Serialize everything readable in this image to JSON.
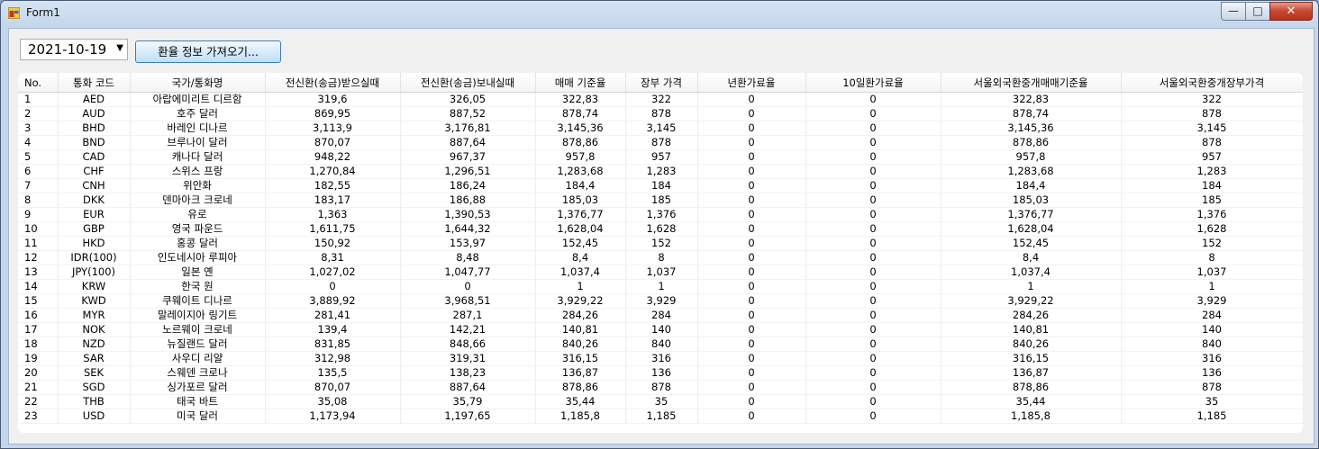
{
  "window": {
    "title": "Form1"
  },
  "toolbar": {
    "date_value": "2021-10-19",
    "fetch_label": "환율 정보 가져오기..."
  },
  "table": {
    "headers": [
      "No.",
      "통화 코드",
      "국가/통화명",
      "전신환(송금)받으실때",
      "전신환(송금)보내실때",
      "매매 기준율",
      "장부 가격",
      "년환가료율",
      "10일환가료율",
      "서울외국환중개매매기준율",
      "서울외국환중개장부가격"
    ],
    "rows": [
      [
        "1",
        "AED",
        "아랍에미리트 디르함",
        "319,6",
        "326,05",
        "322,83",
        "322",
        "0",
        "0",
        "322,83",
        "322"
      ],
      [
        "2",
        "AUD",
        "호주 달러",
        "869,95",
        "887,52",
        "878,74",
        "878",
        "0",
        "0",
        "878,74",
        "878"
      ],
      [
        "3",
        "BHD",
        "바레인 디나르",
        "3,113,9",
        "3,176,81",
        "3,145,36",
        "3,145",
        "0",
        "0",
        "3,145,36",
        "3,145"
      ],
      [
        "4",
        "BND",
        "브루나이 달러",
        "870,07",
        "887,64",
        "878,86",
        "878",
        "0",
        "0",
        "878,86",
        "878"
      ],
      [
        "5",
        "CAD",
        "캐나다 달러",
        "948,22",
        "967,37",
        "957,8",
        "957",
        "0",
        "0",
        "957,8",
        "957"
      ],
      [
        "6",
        "CHF",
        "스위스 프랑",
        "1,270,84",
        "1,296,51",
        "1,283,68",
        "1,283",
        "0",
        "0",
        "1,283,68",
        "1,283"
      ],
      [
        "7",
        "CNH",
        "위안화",
        "182,55",
        "186,24",
        "184,4",
        "184",
        "0",
        "0",
        "184,4",
        "184"
      ],
      [
        "8",
        "DKK",
        "덴마아크 크로네",
        "183,17",
        "186,88",
        "185,03",
        "185",
        "0",
        "0",
        "185,03",
        "185"
      ],
      [
        "9",
        "EUR",
        "유로",
        "1,363",
        "1,390,53",
        "1,376,77",
        "1,376",
        "0",
        "0",
        "1,376,77",
        "1,376"
      ],
      [
        "10",
        "GBP",
        "영국 파운드",
        "1,611,75",
        "1,644,32",
        "1,628,04",
        "1,628",
        "0",
        "0",
        "1,628,04",
        "1,628"
      ],
      [
        "11",
        "HKD",
        "홍콩 달러",
        "150,92",
        "153,97",
        "152,45",
        "152",
        "0",
        "0",
        "152,45",
        "152"
      ],
      [
        "12",
        "IDR(100)",
        "인도네시아 루피아",
        "8,31",
        "8,48",
        "8,4",
        "8",
        "0",
        "0",
        "8,4",
        "8"
      ],
      [
        "13",
        "JPY(100)",
        "일본 옌",
        "1,027,02",
        "1,047,77",
        "1,037,4",
        "1,037",
        "0",
        "0",
        "1,037,4",
        "1,037"
      ],
      [
        "14",
        "KRW",
        "한국 원",
        "0",
        "0",
        "1",
        "1",
        "0",
        "0",
        "1",
        "1"
      ],
      [
        "15",
        "KWD",
        "쿠웨이트 디나르",
        "3,889,92",
        "3,968,51",
        "3,929,22",
        "3,929",
        "0",
        "0",
        "3,929,22",
        "3,929"
      ],
      [
        "16",
        "MYR",
        "말레이지아 링기트",
        "281,41",
        "287,1",
        "284,26",
        "284",
        "0",
        "0",
        "284,26",
        "284"
      ],
      [
        "17",
        "NOK",
        "노르웨이 크로네",
        "139,4",
        "142,21",
        "140,81",
        "140",
        "0",
        "0",
        "140,81",
        "140"
      ],
      [
        "18",
        "NZD",
        "뉴질랜드 달러",
        "831,85",
        "848,66",
        "840,26",
        "840",
        "0",
        "0",
        "840,26",
        "840"
      ],
      [
        "19",
        "SAR",
        "사우디 리얄",
        "312,98",
        "319,31",
        "316,15",
        "316",
        "0",
        "0",
        "316,15",
        "316"
      ],
      [
        "20",
        "SEK",
        "스웨덴 크로나",
        "135,5",
        "138,23",
        "136,87",
        "136",
        "0",
        "0",
        "136,87",
        "136"
      ],
      [
        "21",
        "SGD",
        "싱가포르 달러",
        "870,07",
        "887,64",
        "878,86",
        "878",
        "0",
        "0",
        "878,86",
        "878"
      ],
      [
        "22",
        "THB",
        "태국 바트",
        "35,08",
        "35,79",
        "35,44",
        "35",
        "0",
        "0",
        "35,44",
        "35"
      ],
      [
        "23",
        "USD",
        "미국 달러",
        "1,173,94",
        "1,197,65",
        "1,185,8",
        "1,185",
        "0",
        "0",
        "1,185,8",
        "1,185"
      ]
    ]
  }
}
